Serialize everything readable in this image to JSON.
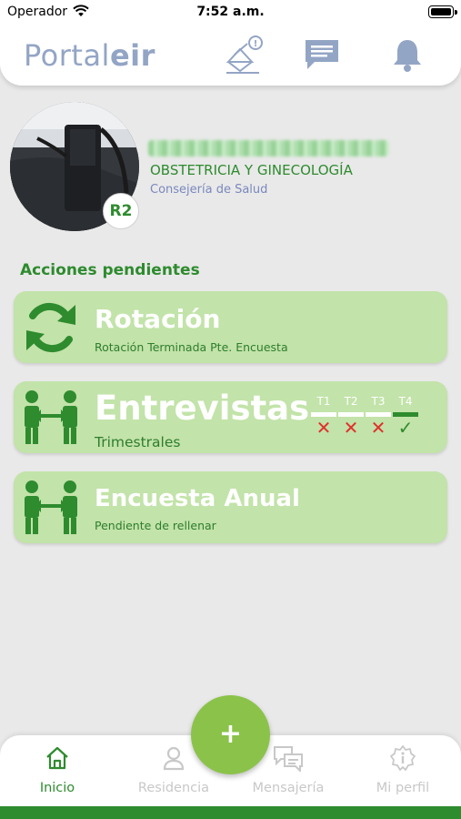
{
  "status_bar": {
    "carrier": "Operador",
    "time": "7:52 a.m."
  },
  "header": {
    "logo_light": "Portal",
    "logo_bold": "eir",
    "icons": [
      "mail-alert-icon",
      "chat-icon",
      "bell-icon"
    ],
    "mail_badge": "!"
  },
  "profile": {
    "rank": "R2",
    "specialty": "OBSTETRICIA Y GINECOLOGÍA",
    "organization": "Consejería de Salud"
  },
  "pending": {
    "title": "Acciones pendientes",
    "cards": [
      {
        "icon": "sync-icon",
        "title": "Rotación",
        "subtitle": "Rotación Terminada Pte. Encuesta"
      },
      {
        "icon": "people-exchange-icon",
        "title": "Entrevistas",
        "subtitle": "Trimestrales",
        "quarters": [
          {
            "label": "T1",
            "done": false,
            "mark": "✕"
          },
          {
            "label": "T2",
            "done": false,
            "mark": "✕"
          },
          {
            "label": "T3",
            "done": false,
            "mark": "✕"
          },
          {
            "label": "T4",
            "done": true,
            "mark": "✓"
          }
        ]
      },
      {
        "icon": "people-exchange-icon",
        "title": "Encuesta Anual",
        "subtitle": "Pendiente de rellenar"
      }
    ]
  },
  "fab": {
    "label": "+"
  },
  "nav": {
    "items": [
      {
        "label": "Inicio",
        "icon": "home-icon",
        "active": true
      },
      {
        "label": "Residencia",
        "icon": "person-icon",
        "active": false
      },
      {
        "label": "Mensajería",
        "icon": "chat-bubbles-icon",
        "active": false
      },
      {
        "label": "Mi perfil",
        "icon": "info-gear-icon",
        "active": false
      }
    ]
  },
  "colors": {
    "accent_green": "#2e8b2e",
    "card_green": "#c2e3a9",
    "fab_green": "#8bc34a",
    "logo_blue": "#93a5c5",
    "error_red": "#e0302d"
  }
}
